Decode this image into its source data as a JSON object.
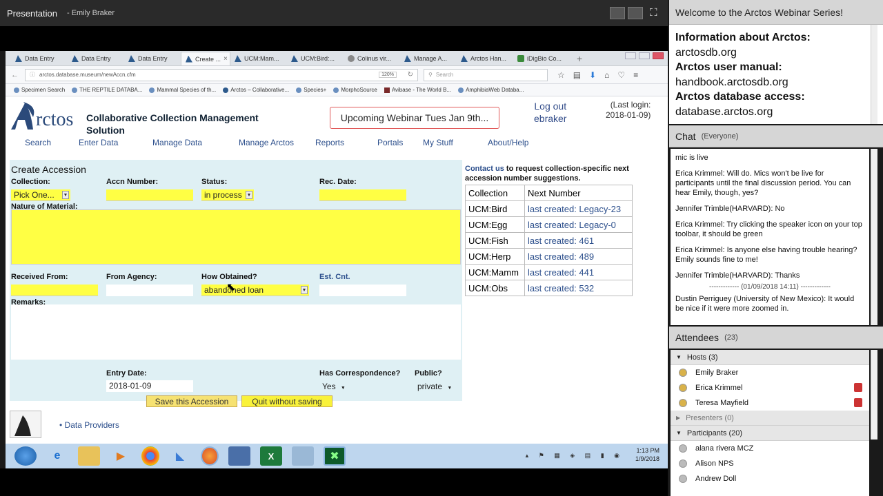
{
  "presentation": {
    "title": "Presentation",
    "presenter": "- Emily Braker"
  },
  "browser": {
    "tabs": [
      {
        "label": "Data Entry",
        "icon": "arctos-icon"
      },
      {
        "label": "Data Entry",
        "icon": "arctos-icon"
      },
      {
        "label": "Data Entry",
        "icon": "arctos-icon"
      },
      {
        "label": "Create ...",
        "icon": "arctos-icon",
        "active": true
      },
      {
        "label": "UCM:Mam...",
        "icon": "arctos-icon"
      },
      {
        "label": "UCM:Bird:...",
        "icon": "arctos-icon"
      },
      {
        "label": "Colinus vir...",
        "icon": "globe-icon"
      },
      {
        "label": "Manage A...",
        "icon": "arctos-icon"
      },
      {
        "label": "Arctos Han...",
        "icon": "arctos-icon"
      },
      {
        "label": "iDigBio Co...",
        "icon": "idigbio-icon"
      }
    ],
    "url": "arctos.database.museum/newAccn.cfm",
    "zoom": "120%",
    "search_placeholder": "Search",
    "bookmarks": [
      "Specimen Search",
      "THE REPTILE DATABA...",
      "Mammal Species of th...",
      "Arctos – Collaborative...",
      "Species+",
      "MorphoSource",
      "Avibase - The World B...",
      "AmphibiaWeb Databa..."
    ]
  },
  "page": {
    "logo_text": "rctos",
    "subtitle_line1": "Collaborative Collection Management",
    "subtitle_line2": "Solution",
    "webinar": "Upcoming Webinar Tues Jan 9th...",
    "logout_line1": "Log out",
    "logout_line2": "ebraker",
    "last_login_line1": "(Last login:",
    "last_login_line2": "2018-01-09)",
    "menu": [
      "Search",
      "Enter Data",
      "Manage Data",
      "Manage Arctos",
      "Reports",
      "Portals",
      "My Stuff",
      "About/Help"
    ]
  },
  "form": {
    "title": "Create Accession",
    "collection_label": "Collection:",
    "collection_value": "Pick One...",
    "accn_label": "Accn Number:",
    "status_label": "Status:",
    "status_value": "in process",
    "rec_date_label": "Rec. Date:",
    "nature_label": "Nature of Material:",
    "received_from_label": "Received From:",
    "from_agency_label": "From Agency:",
    "how_obtained_label": "How Obtained?",
    "how_obtained_value": "abandoned loan",
    "est_cnt_label": "Est. Cnt.",
    "remarks_label": "Remarks:",
    "entry_date_label": "Entry Date:",
    "entry_date_value": "2018-01-09",
    "correspondence_label": "Has Correspondence?",
    "correspondence_value": "Yes",
    "public_label": "Public?",
    "public_value": "private",
    "save_button": "Save this Accession",
    "quit_button": "Quit without saving"
  },
  "contact": {
    "link": "Contact us",
    "text": " to request collection-specific next accession number suggestions."
  },
  "next_numbers": {
    "headers": [
      "Collection",
      "Next Number"
    ],
    "rows": [
      [
        "UCM:Bird",
        "last created: Legacy-23"
      ],
      [
        "UCM:Egg",
        "last created: Legacy-0"
      ],
      [
        "UCM:Fish",
        "last created: 461"
      ],
      [
        "UCM:Herp",
        "last created: 489"
      ],
      [
        "UCM:Mamm",
        "last created: 441"
      ],
      [
        "UCM:Obs",
        "last created: 532"
      ]
    ]
  },
  "footer": {
    "link": "Data Providers"
  },
  "taskbar": {
    "time": "1:13 PM",
    "date": "1/9/2018"
  },
  "welcome": {
    "title": "Welcome to the Arctos Webinar Series!"
  },
  "info": {
    "lines": [
      {
        "label": "Information about Arctos:",
        "value": "arctosdb.org"
      },
      {
        "label": "Arctos user manual:",
        "value": "handbook.arctosdb.org"
      },
      {
        "label": "Arctos database access:",
        "value": "database.arctos.org"
      }
    ]
  },
  "chat": {
    "title": "Chat",
    "scope": "(Everyone)",
    "messages": [
      {
        "author": "",
        "text": "mic is live"
      },
      {
        "author": "Erica Krimmel:",
        "text": " Will do. Mics won't be live for participants until the final discussion period. You can hear Emily, though, yes?"
      },
      {
        "author": "Jennifer Trimble(HARVARD):",
        "text": " No"
      },
      {
        "author": "Erica Krimmel:",
        "text": " Try clicking the speaker icon on your top toolbar, it should be green"
      },
      {
        "author": "Erica Krimmel:",
        "text": " Is anyone else having trouble hearing? Emily sounds fine to me!"
      },
      {
        "author": "Jennifer Trimble(HARVARD):",
        "text": " Thanks"
      },
      {
        "author": "Dustin Perriguey (University of New Mexico):",
        "text": " It would be nice if it were more zoomed in."
      }
    ],
    "separator": "------------- (01/09/2018 14:11) -------------"
  },
  "attendees": {
    "title": "Attendees",
    "count": "(23)",
    "hosts_label": "Hosts (3)",
    "hosts": [
      "Emily Braker",
      "Erica Krimmel",
      "Teresa Mayfield"
    ],
    "presenters_label": "Presenters (0)",
    "participants_label": "Participants (20)",
    "participants": [
      "alana rivera MCZ",
      "Alison NPS",
      "Andrew Doll"
    ]
  }
}
